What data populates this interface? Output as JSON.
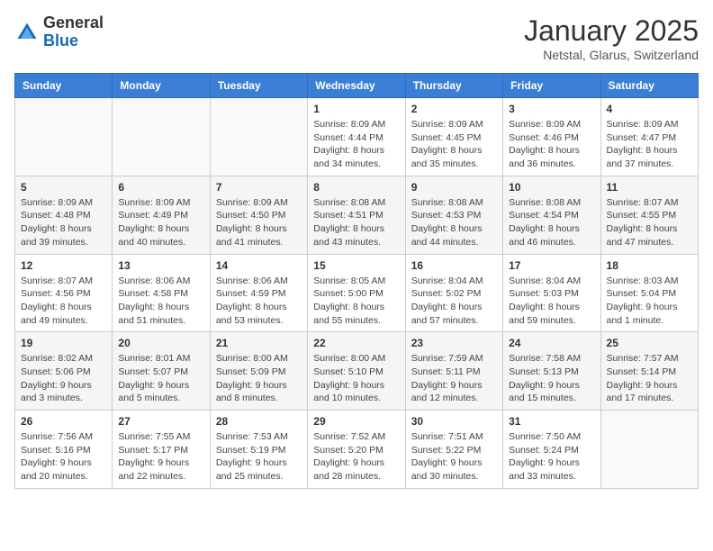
{
  "header": {
    "logo_general": "General",
    "logo_blue": "Blue",
    "title": "January 2025",
    "location": "Netstal, Glarus, Switzerland"
  },
  "weekdays": [
    "Sunday",
    "Monday",
    "Tuesday",
    "Wednesday",
    "Thursday",
    "Friday",
    "Saturday"
  ],
  "weeks": [
    [
      {
        "day": "",
        "sunrise": "",
        "sunset": "",
        "daylight": ""
      },
      {
        "day": "",
        "sunrise": "",
        "sunset": "",
        "daylight": ""
      },
      {
        "day": "",
        "sunrise": "",
        "sunset": "",
        "daylight": ""
      },
      {
        "day": "1",
        "sunrise": "Sunrise: 8:09 AM",
        "sunset": "Sunset: 4:44 PM",
        "daylight": "Daylight: 8 hours and 34 minutes."
      },
      {
        "day": "2",
        "sunrise": "Sunrise: 8:09 AM",
        "sunset": "Sunset: 4:45 PM",
        "daylight": "Daylight: 8 hours and 35 minutes."
      },
      {
        "day": "3",
        "sunrise": "Sunrise: 8:09 AM",
        "sunset": "Sunset: 4:46 PM",
        "daylight": "Daylight: 8 hours and 36 minutes."
      },
      {
        "day": "4",
        "sunrise": "Sunrise: 8:09 AM",
        "sunset": "Sunset: 4:47 PM",
        "daylight": "Daylight: 8 hours and 37 minutes."
      }
    ],
    [
      {
        "day": "5",
        "sunrise": "Sunrise: 8:09 AM",
        "sunset": "Sunset: 4:48 PM",
        "daylight": "Daylight: 8 hours and 39 minutes."
      },
      {
        "day": "6",
        "sunrise": "Sunrise: 8:09 AM",
        "sunset": "Sunset: 4:49 PM",
        "daylight": "Daylight: 8 hours and 40 minutes."
      },
      {
        "day": "7",
        "sunrise": "Sunrise: 8:09 AM",
        "sunset": "Sunset: 4:50 PM",
        "daylight": "Daylight: 8 hours and 41 minutes."
      },
      {
        "day": "8",
        "sunrise": "Sunrise: 8:08 AM",
        "sunset": "Sunset: 4:51 PM",
        "daylight": "Daylight: 8 hours and 43 minutes."
      },
      {
        "day": "9",
        "sunrise": "Sunrise: 8:08 AM",
        "sunset": "Sunset: 4:53 PM",
        "daylight": "Daylight: 8 hours and 44 minutes."
      },
      {
        "day": "10",
        "sunrise": "Sunrise: 8:08 AM",
        "sunset": "Sunset: 4:54 PM",
        "daylight": "Daylight: 8 hours and 46 minutes."
      },
      {
        "day": "11",
        "sunrise": "Sunrise: 8:07 AM",
        "sunset": "Sunset: 4:55 PM",
        "daylight": "Daylight: 8 hours and 47 minutes."
      }
    ],
    [
      {
        "day": "12",
        "sunrise": "Sunrise: 8:07 AM",
        "sunset": "Sunset: 4:56 PM",
        "daylight": "Daylight: 8 hours and 49 minutes."
      },
      {
        "day": "13",
        "sunrise": "Sunrise: 8:06 AM",
        "sunset": "Sunset: 4:58 PM",
        "daylight": "Daylight: 8 hours and 51 minutes."
      },
      {
        "day": "14",
        "sunrise": "Sunrise: 8:06 AM",
        "sunset": "Sunset: 4:59 PM",
        "daylight": "Daylight: 8 hours and 53 minutes."
      },
      {
        "day": "15",
        "sunrise": "Sunrise: 8:05 AM",
        "sunset": "Sunset: 5:00 PM",
        "daylight": "Daylight: 8 hours and 55 minutes."
      },
      {
        "day": "16",
        "sunrise": "Sunrise: 8:04 AM",
        "sunset": "Sunset: 5:02 PM",
        "daylight": "Daylight: 8 hours and 57 minutes."
      },
      {
        "day": "17",
        "sunrise": "Sunrise: 8:04 AM",
        "sunset": "Sunset: 5:03 PM",
        "daylight": "Daylight: 8 hours and 59 minutes."
      },
      {
        "day": "18",
        "sunrise": "Sunrise: 8:03 AM",
        "sunset": "Sunset: 5:04 PM",
        "daylight": "Daylight: 9 hours and 1 minute."
      }
    ],
    [
      {
        "day": "19",
        "sunrise": "Sunrise: 8:02 AM",
        "sunset": "Sunset: 5:06 PM",
        "daylight": "Daylight: 9 hours and 3 minutes."
      },
      {
        "day": "20",
        "sunrise": "Sunrise: 8:01 AM",
        "sunset": "Sunset: 5:07 PM",
        "daylight": "Daylight: 9 hours and 5 minutes."
      },
      {
        "day": "21",
        "sunrise": "Sunrise: 8:00 AM",
        "sunset": "Sunset: 5:09 PM",
        "daylight": "Daylight: 9 hours and 8 minutes."
      },
      {
        "day": "22",
        "sunrise": "Sunrise: 8:00 AM",
        "sunset": "Sunset: 5:10 PM",
        "daylight": "Daylight: 9 hours and 10 minutes."
      },
      {
        "day": "23",
        "sunrise": "Sunrise: 7:59 AM",
        "sunset": "Sunset: 5:11 PM",
        "daylight": "Daylight: 9 hours and 12 minutes."
      },
      {
        "day": "24",
        "sunrise": "Sunrise: 7:58 AM",
        "sunset": "Sunset: 5:13 PM",
        "daylight": "Daylight: 9 hours and 15 minutes."
      },
      {
        "day": "25",
        "sunrise": "Sunrise: 7:57 AM",
        "sunset": "Sunset: 5:14 PM",
        "daylight": "Daylight: 9 hours and 17 minutes."
      }
    ],
    [
      {
        "day": "26",
        "sunrise": "Sunrise: 7:56 AM",
        "sunset": "Sunset: 5:16 PM",
        "daylight": "Daylight: 9 hours and 20 minutes."
      },
      {
        "day": "27",
        "sunrise": "Sunrise: 7:55 AM",
        "sunset": "Sunset: 5:17 PM",
        "daylight": "Daylight: 9 hours and 22 minutes."
      },
      {
        "day": "28",
        "sunrise": "Sunrise: 7:53 AM",
        "sunset": "Sunset: 5:19 PM",
        "daylight": "Daylight: 9 hours and 25 minutes."
      },
      {
        "day": "29",
        "sunrise": "Sunrise: 7:52 AM",
        "sunset": "Sunset: 5:20 PM",
        "daylight": "Daylight: 9 hours and 28 minutes."
      },
      {
        "day": "30",
        "sunrise": "Sunrise: 7:51 AM",
        "sunset": "Sunset: 5:22 PM",
        "daylight": "Daylight: 9 hours and 30 minutes."
      },
      {
        "day": "31",
        "sunrise": "Sunrise: 7:50 AM",
        "sunset": "Sunset: 5:24 PM",
        "daylight": "Daylight: 9 hours and 33 minutes."
      },
      {
        "day": "",
        "sunrise": "",
        "sunset": "",
        "daylight": ""
      }
    ]
  ]
}
